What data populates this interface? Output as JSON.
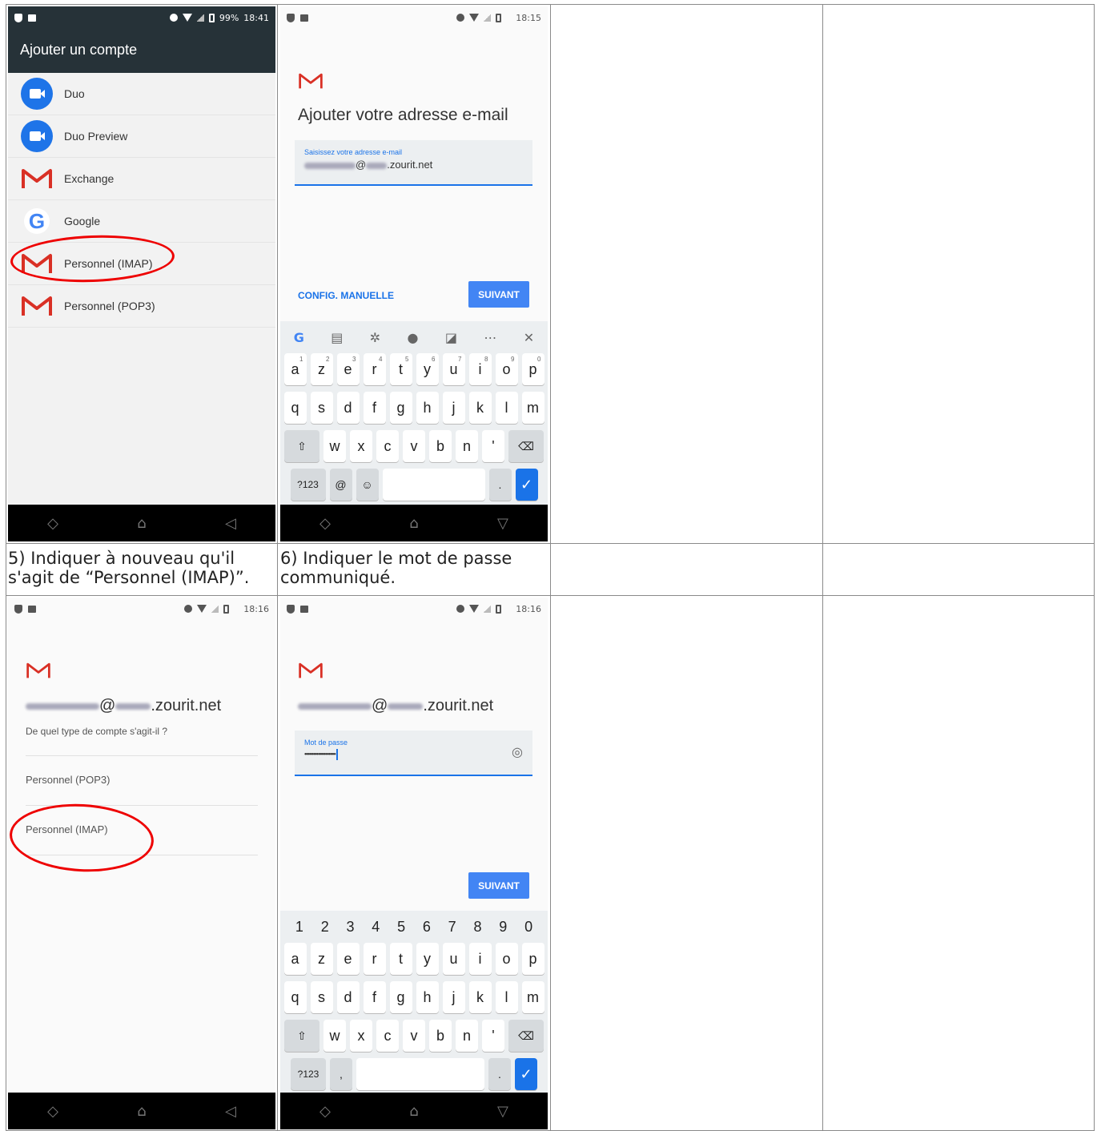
{
  "captions": {
    "step5": "5) Indiquer à nouveau qu'il s'agit de “Personnel (IMAP)”.",
    "step6": "6) Indiquer le mot de passe communiqué."
  },
  "screen1": {
    "status_battery": "99%",
    "status_time": "18:41",
    "title": "Ajouter un compte",
    "accounts": [
      {
        "label": "Duo",
        "icon": "duo-icon"
      },
      {
        "label": "Duo Preview",
        "icon": "duo-icon"
      },
      {
        "label": "Exchange",
        "icon": "gmail-icon"
      },
      {
        "label": "Google",
        "icon": "google-icon"
      },
      {
        "label": "Personnel (IMAP)",
        "icon": "gmail-icon"
      },
      {
        "label": "Personnel (POP3)",
        "icon": "gmail-icon"
      }
    ]
  },
  "screen2": {
    "status_time": "18:15",
    "heading": "Ajouter votre adresse e-mail",
    "field_label": "Saisissez votre adresse e-mail",
    "field_suffix": "@",
    "field_domain": ".zourit.net",
    "manual_config": "CONFIG. MANUELLE",
    "next": "SUIVANT",
    "kb_row1": [
      [
        "a",
        "1"
      ],
      [
        "z",
        "2"
      ],
      [
        "e",
        "3"
      ],
      [
        "r",
        "4"
      ],
      [
        "t",
        "5"
      ],
      [
        "y",
        "6"
      ],
      [
        "u",
        "7"
      ],
      [
        "i",
        "8"
      ],
      [
        "o",
        "9"
      ],
      [
        "p",
        "0"
      ]
    ],
    "kb_row2": [
      "q",
      "s",
      "d",
      "f",
      "g",
      "h",
      "j",
      "k",
      "l",
      "m"
    ],
    "kb_row3": [
      "w",
      "x",
      "c",
      "v",
      "b",
      "n",
      "'"
    ],
    "kb_sym": "?123",
    "kb_at": "@",
    "kb_dot": "."
  },
  "screen3": {
    "status_time": "18:16",
    "email_at": "@",
    "email_domain": ".zourit.net",
    "question": "De quel type de compte s'agit-il ?",
    "option_pop3": "Personnel (POP3)",
    "option_imap": "Personnel (IMAP)"
  },
  "screen4": {
    "status_time": "18:16",
    "email_at": "@",
    "email_domain": ".zourit.net",
    "field_label": "Mot de passe",
    "field_value": "••••••••••••••••••",
    "next": "SUIVANT",
    "kb_nums": [
      "1",
      "2",
      "3",
      "4",
      "5",
      "6",
      "7",
      "8",
      "9",
      "0"
    ],
    "kb_row1": [
      "a",
      "z",
      "e",
      "r",
      "t",
      "y",
      "u",
      "i",
      "o",
      "p"
    ],
    "kb_row2": [
      "q",
      "s",
      "d",
      "f",
      "g",
      "h",
      "j",
      "k",
      "l",
      "m"
    ],
    "kb_row3": [
      "w",
      "x",
      "c",
      "v",
      "b",
      "n",
      "'"
    ],
    "kb_sym": "?123",
    "kb_comma": ",",
    "kb_dot": "."
  }
}
